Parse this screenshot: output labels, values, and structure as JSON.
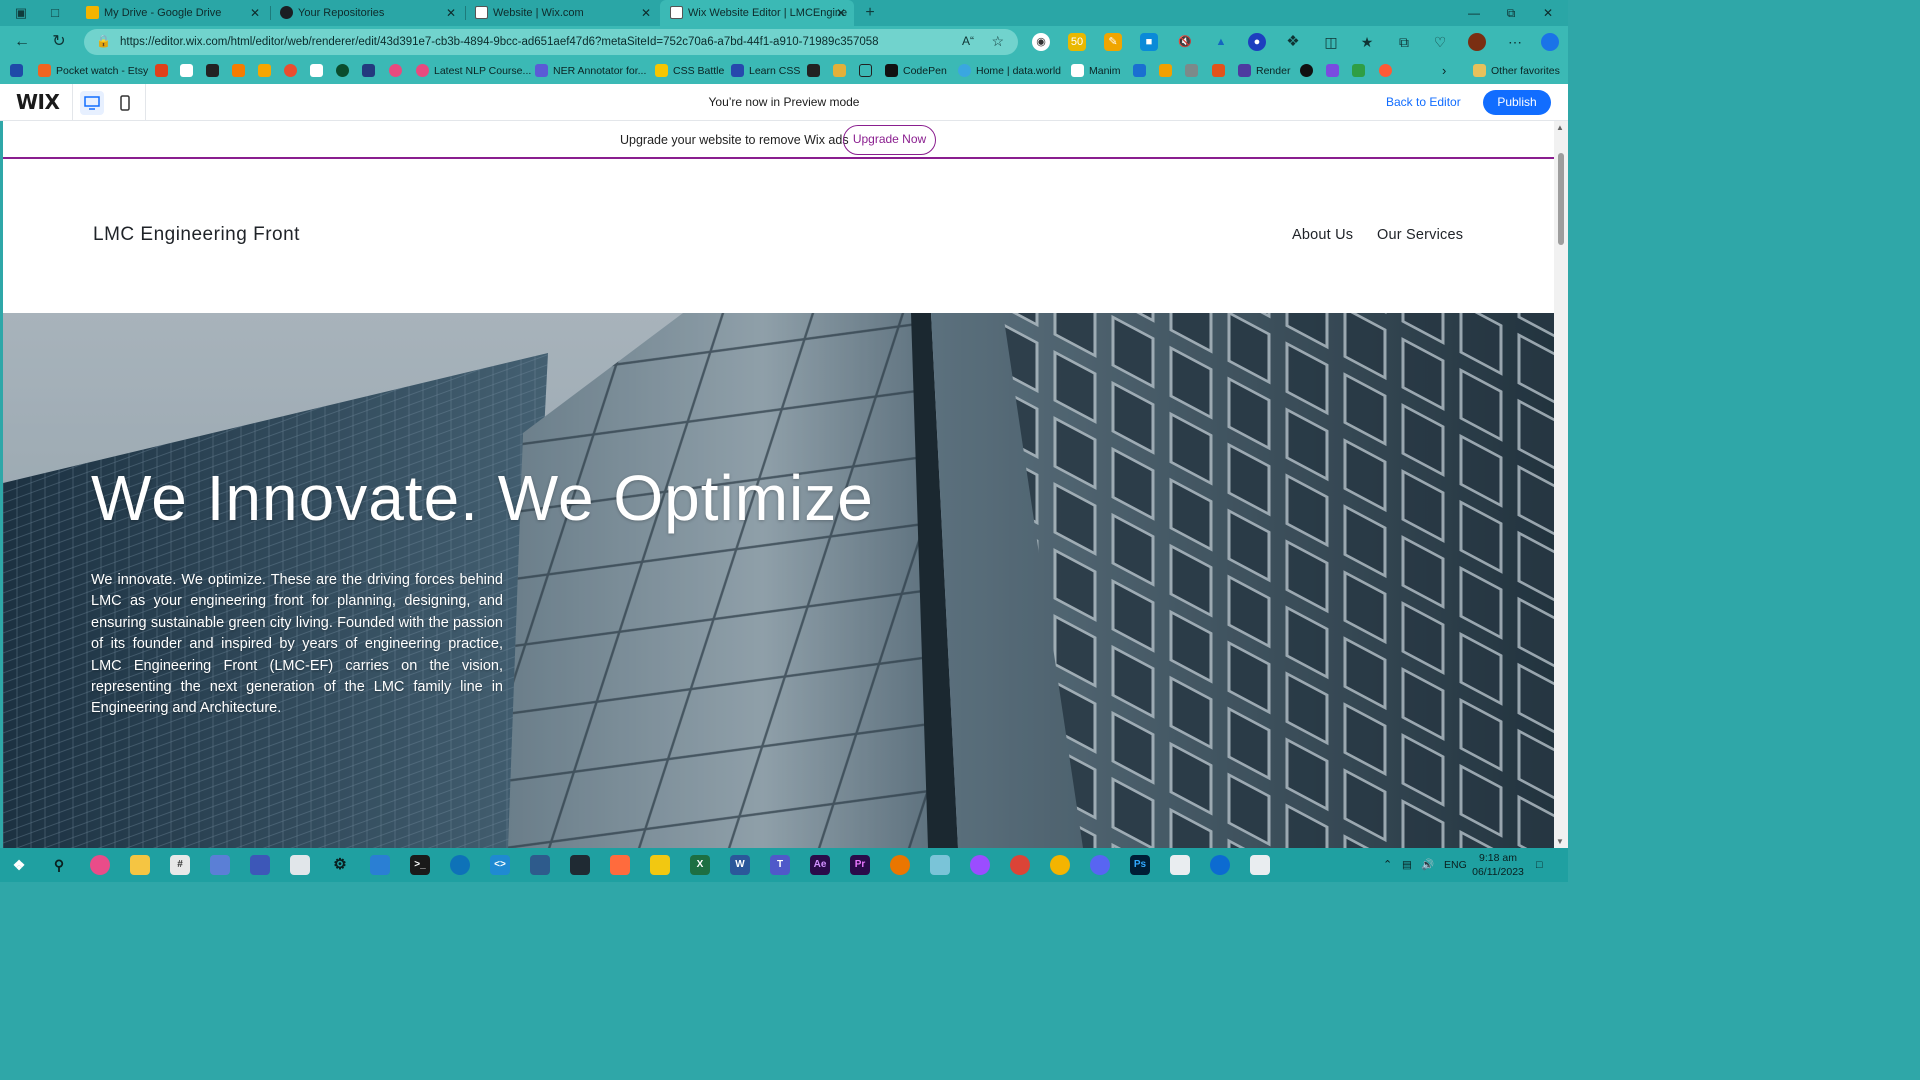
{
  "browser": {
    "tabs": [
      {
        "title": "My Drive - Google Drive",
        "icon": "google-drive-icon",
        "color": "#f4b400"
      },
      {
        "title": "Your Repositories",
        "icon": "github-icon",
        "color": "#1b1f23"
      },
      {
        "title": "Website | Wix.com",
        "icon": "wix-icon",
        "color": "#ffffff"
      },
      {
        "title": "Wix Website Editor | LMCEngine",
        "icon": "wix-icon",
        "color": "#ffffff"
      }
    ],
    "url": "https://editor.wix.com/html/editor/web/renderer/edit/43d391e7-cb3b-4894-9bcc-ad651aef47d6?metaSiteId=752c70a6-a7bd-44f1-a910-71989c357058",
    "bookmarks": [
      {
        "label": "Pocket watch - Etsy",
        "color": "#f16521"
      },
      {
        "label": "Latest NLP Course...",
        "color": "#e84a7f"
      },
      {
        "label": "NER Annotator for...",
        "color": "#5b5bd6"
      },
      {
        "label": "CSS Battle",
        "color": "#f7c600"
      },
      {
        "label": "Learn CSS",
        "color": "#2748ad"
      },
      {
        "label": "CodePen",
        "color": "#111111"
      },
      {
        "label": "Home | data.world",
        "color": "#3aa7e0"
      },
      {
        "label": "Manim",
        "color": "#ffffff"
      },
      {
        "label": "Render",
        "color": "#4e3aa0"
      },
      {
        "label": "Other favorites",
        "color": "#e7c15b"
      }
    ]
  },
  "wix": {
    "logo": "WIX",
    "preview_text": "You’re now in Preview mode",
    "back_label": "Back to Editor",
    "publish_label": "Publish",
    "ad_text": "Upgrade your website to remove Wix ads",
    "upgrade_label": "Upgrade Now",
    "accent": "#116dff",
    "ad_accent": "#8a1e8f"
  },
  "site": {
    "title": "LMC Engineering Front",
    "nav": [
      "About Us",
      "Our Services"
    ],
    "hero_title": "We Innovate. We Optimize",
    "hero_body": "We innovate. We optimize. These are the driving forces behind LMC as your engineering front for planning, designing, and ensuring sustainable green city living. Founded with the passion of its founder and inspired by years of engineering practice, LMC Engineering Front (LMC-EF) carries on the vision, representing the next generation of the LMC family line in Engineering and Architecture."
  },
  "taskbar": {
    "language": "ENG",
    "time": "9:18 am",
    "date": "06/11/2023"
  }
}
